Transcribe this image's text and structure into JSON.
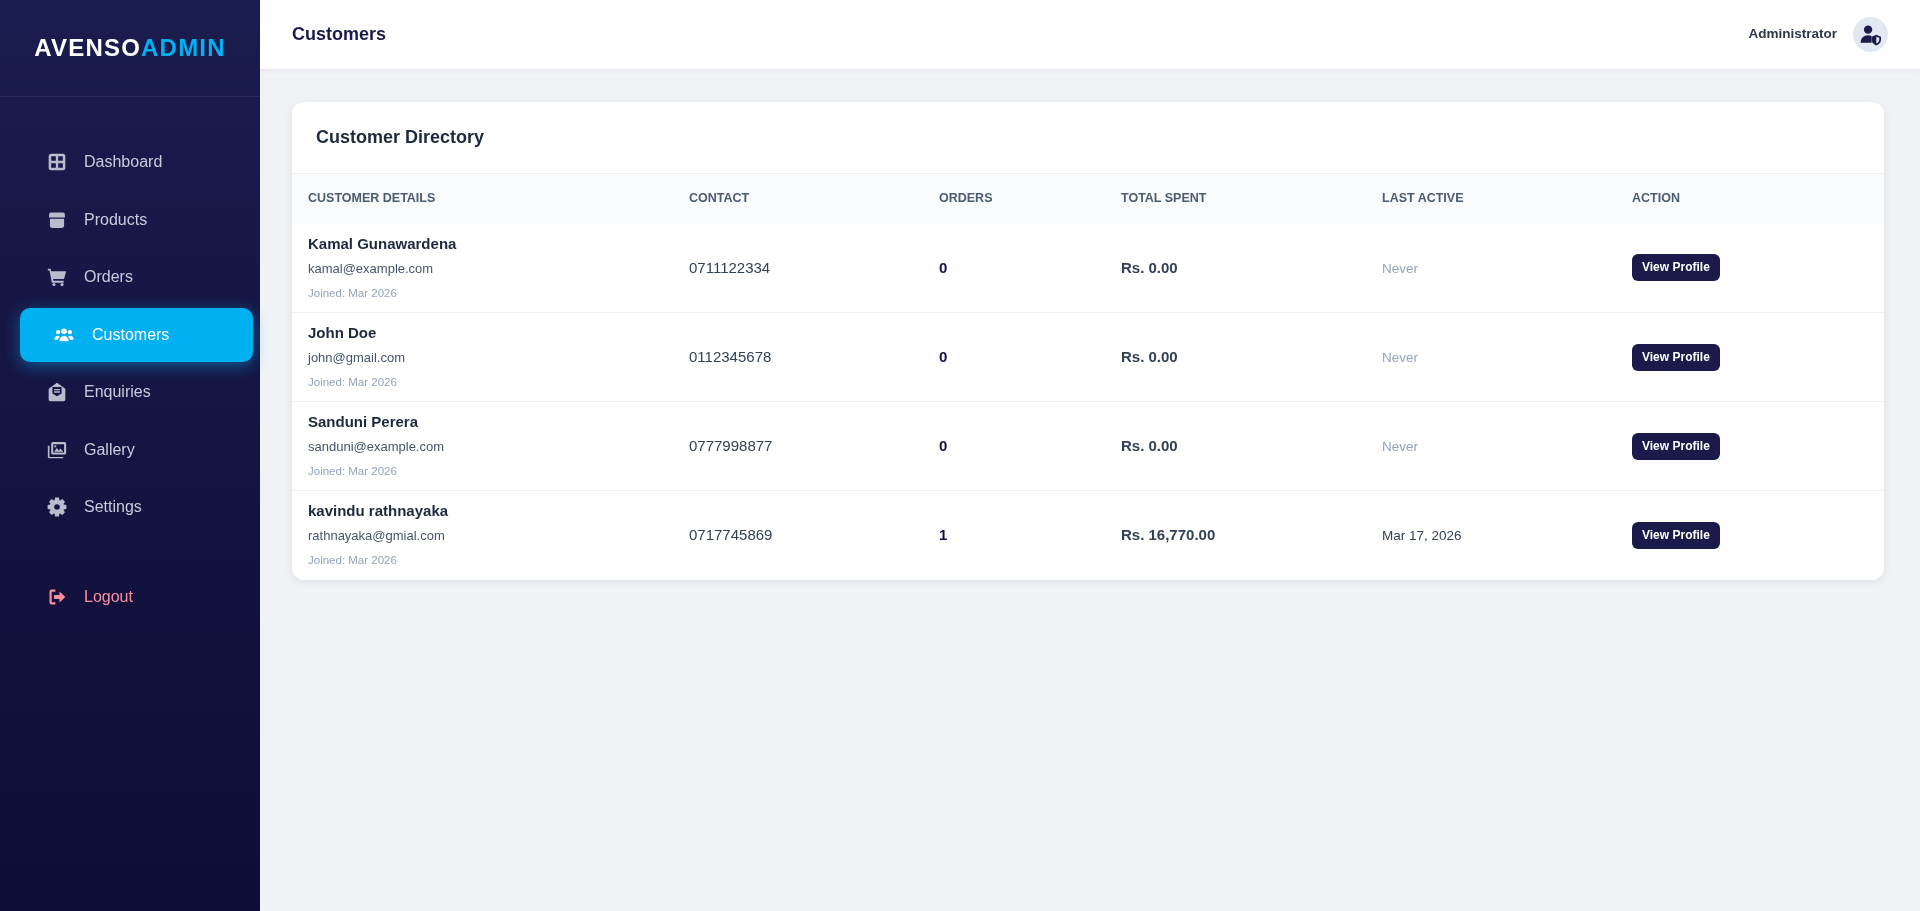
{
  "sidebar": {
    "logo": {
      "part_1": "AVENSO",
      "part_2": "ADMIN"
    },
    "items": [
      {
        "label": "Dashboard",
        "kind": "link",
        "selected": false
      },
      {
        "label": "Products",
        "kind": "link",
        "selected": false
      },
      {
        "label": "Orders",
        "kind": "link",
        "selected": false
      },
      {
        "label": "Customers",
        "kind": "link",
        "selected": true
      },
      {
        "label": "Enquiries",
        "kind": "link",
        "selected": false
      },
      {
        "label": "Gallery",
        "kind": "link",
        "selected": false
      },
      {
        "label": "Settings",
        "kind": "link",
        "selected": false
      },
      {
        "label": "Logout",
        "kind": "logout",
        "selected": false
      }
    ]
  },
  "header": {
    "title": "Customers",
    "user_name": "Administrator"
  },
  "directory": {
    "title": "Customer Directory",
    "columns": [
      "CUSTOMER DETAILS",
      "CONTACT",
      "ORDERS",
      "TOTAL SPENT",
      "LAST ACTIVE",
      "ACTION"
    ],
    "rows": [
      {
        "name": "Kamal Gunawardena",
        "email": "kamal@example.com",
        "joined": "Joined: Mar 2026",
        "contact": "0711122334",
        "orders": "0",
        "total_spent": "Rs. 0.00",
        "last_active": "Never",
        "last_active_muted": true,
        "action": "View Profile"
      },
      {
        "name": "John Doe",
        "email": "john@gmail.com",
        "joined": "Joined: Mar 2026",
        "contact": "0112345678",
        "orders": "0",
        "total_spent": "Rs. 0.00",
        "last_active": "Never",
        "last_active_muted": true,
        "action": "View Profile"
      },
      {
        "name": "Sanduni Perera",
        "email": "sanduni@example.com",
        "joined": "Joined: Mar 2026",
        "contact": "0777998877",
        "orders": "0",
        "total_spent": "Rs. 0.00",
        "last_active": "Never",
        "last_active_muted": true,
        "action": "View Profile"
      },
      {
        "name": "kavindu rathnayaka",
        "email": "rathnayaka@gmial.com",
        "joined": "Joined: Mar 2026",
        "contact": "0717745869",
        "orders": "1",
        "total_spent": "Rs. 16,770.00",
        "last_active": "Mar 17, 2026",
        "last_active_muted": false,
        "action": "View Profile"
      }
    ]
  }
}
